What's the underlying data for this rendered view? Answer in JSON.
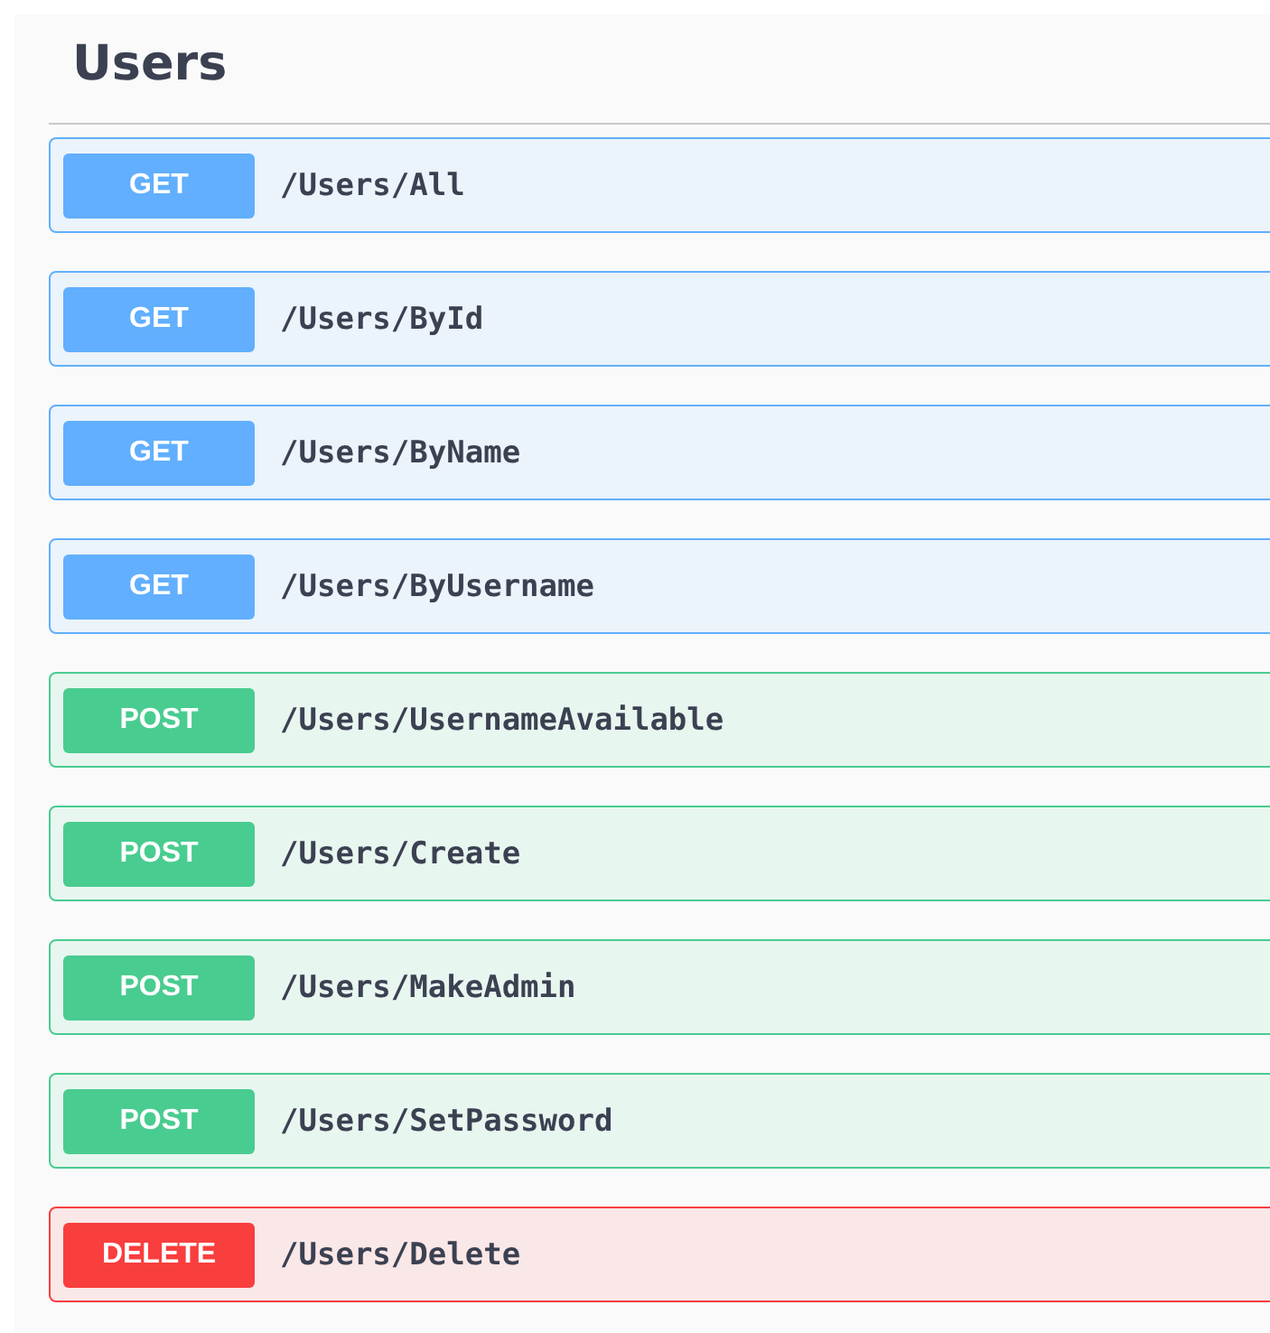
{
  "section": {
    "title": "Users"
  },
  "operations": [
    {
      "kind": "get",
      "method": "GET",
      "path": "/Users/All"
    },
    {
      "kind": "get",
      "method": "GET",
      "path": "/Users/ById"
    },
    {
      "kind": "get",
      "method": "GET",
      "path": "/Users/ByName"
    },
    {
      "kind": "get",
      "method": "GET",
      "path": "/Users/ByUsername"
    },
    {
      "kind": "post",
      "method": "POST",
      "path": "/Users/UsernameAvailable"
    },
    {
      "kind": "post",
      "method": "POST",
      "path": "/Users/Create"
    },
    {
      "kind": "post",
      "method": "POST",
      "path": "/Users/MakeAdmin"
    },
    {
      "kind": "post",
      "method": "POST",
      "path": "/Users/SetPassword"
    },
    {
      "kind": "delete",
      "method": "DELETE",
      "path": "/Users/Delete"
    }
  ]
}
